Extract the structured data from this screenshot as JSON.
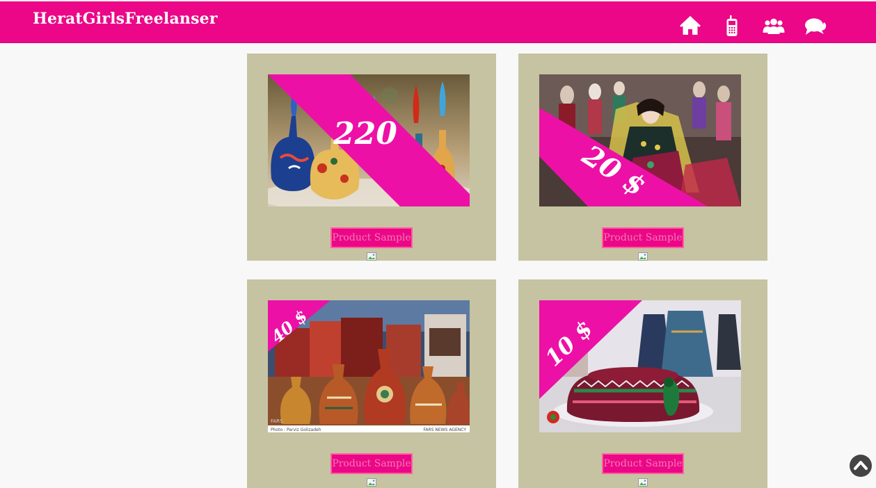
{
  "brand": "HeratGirlsFreelanser",
  "nav": {
    "icons": [
      "home-icon",
      "phone-icon",
      "users-icon",
      "chat-icon"
    ]
  },
  "colors": {
    "primary": "#eb0787",
    "card_bg": "#c5c3a2",
    "page_bg": "#f8f8f8"
  },
  "products": [
    {
      "price": "220",
      "button": "Product Sample"
    },
    {
      "price": "20 $",
      "button": "Product Sample"
    },
    {
      "price": "40 $",
      "button": "Product Sample"
    },
    {
      "price": "10 $",
      "button": "Product Sample"
    }
  ],
  "image_credits": {
    "photographer": "Photo : Parviz Golizadeh",
    "agency": "FARS NEWS AGENCY",
    "watermark": "FARS"
  },
  "scroll_top_icon": "chevron-up-icon"
}
